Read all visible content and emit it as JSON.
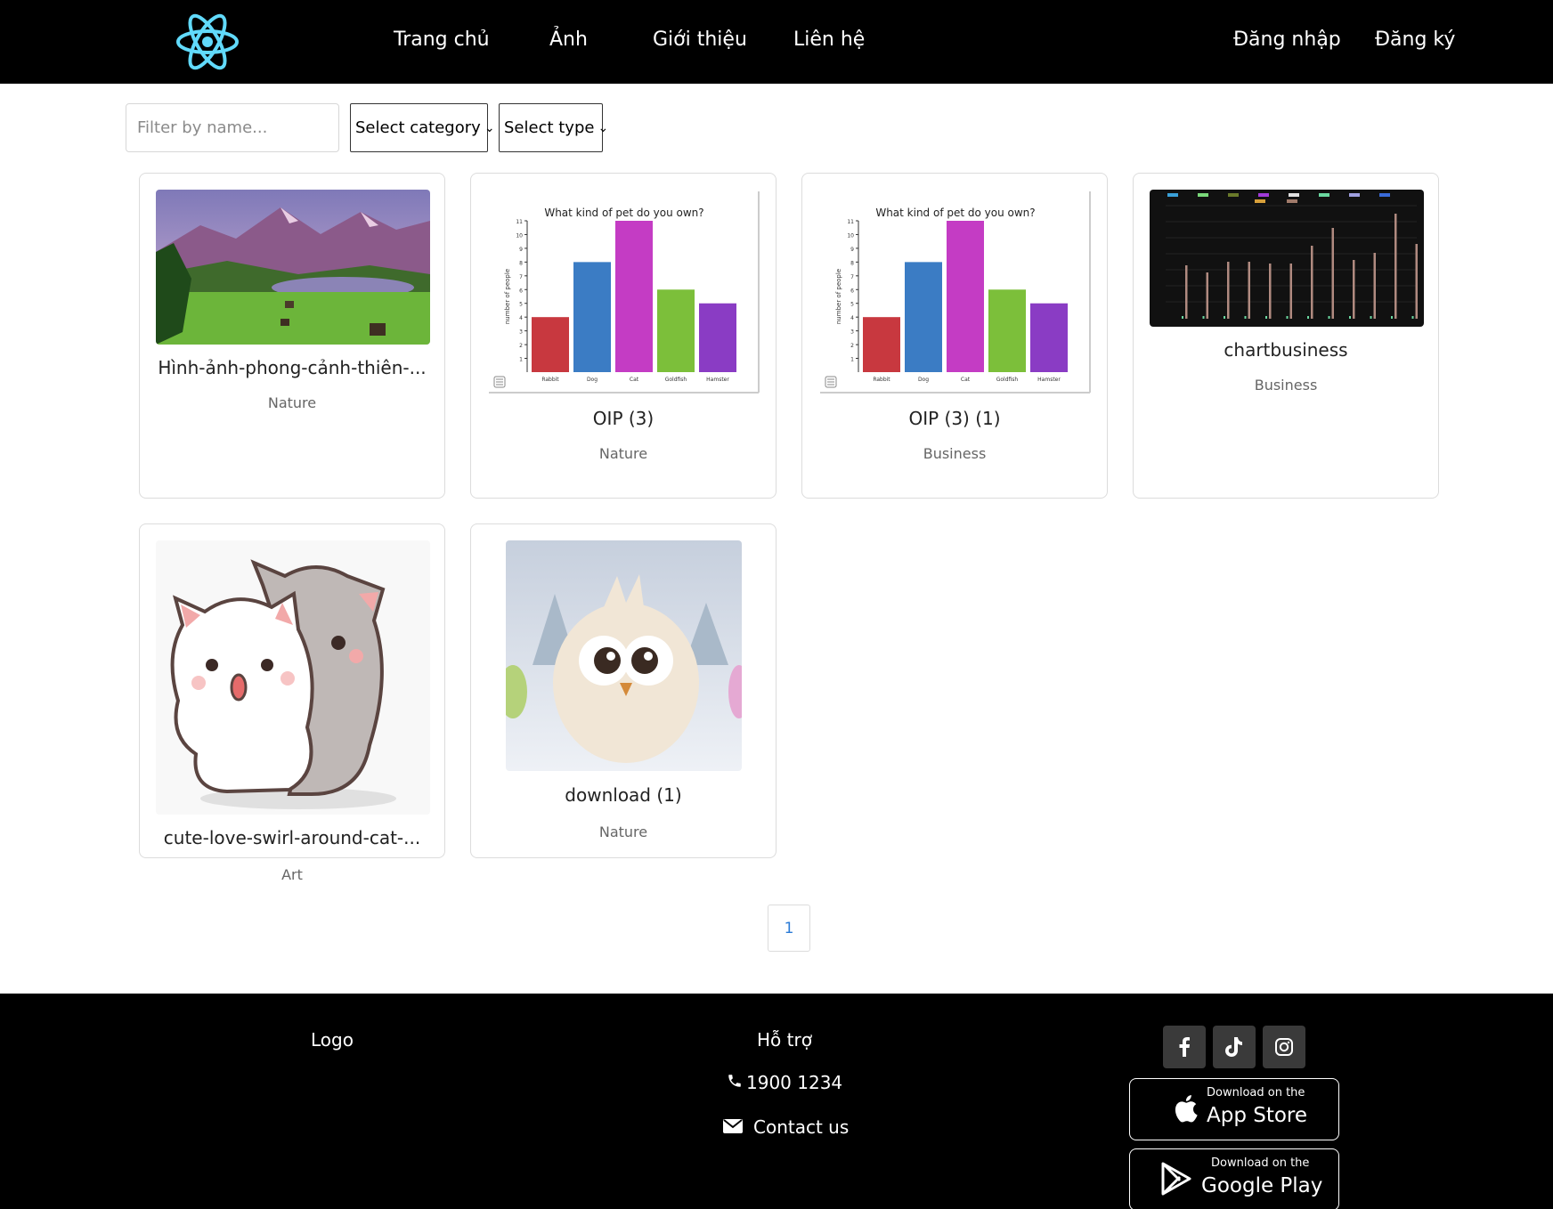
{
  "nav": {
    "logo_icon": "react-atom-icon",
    "links": [
      "Trang chủ",
      "Ảnh",
      "Giới thiệu",
      "Liên hệ"
    ],
    "login": "Đăng nhập",
    "register": "Đăng ký"
  },
  "filters": {
    "name_placeholder": "Filter by name...",
    "category": "Select category",
    "type": "Select type"
  },
  "cards": [
    {
      "title": "Hình-ảnh-phong-cảnh-thiên-...",
      "category": "Nature",
      "image": "mountain-lake-landscape"
    },
    {
      "title": "OIP (3)",
      "category": "Nature",
      "image": "pet-bar-chart"
    },
    {
      "title": "OIP (3) (1)",
      "category": "Business",
      "image": "pet-bar-chart"
    },
    {
      "title": "chartbusiness",
      "category": "Business",
      "image": "dark-business-chart"
    },
    {
      "title": "cute-love-swirl-around-cat-...",
      "category": "Art",
      "image": "cartoon-cats"
    },
    {
      "title": "download (1)",
      "category": "Nature",
      "image": "fluffy-chick"
    }
  ],
  "pet_chart": {
    "title": "What kind of pet do you own?",
    "ylabel": "number of people",
    "categories": [
      "Rabbit",
      "Dog",
      "Cat",
      "Goldfish",
      "Hamster"
    ],
    "values": [
      4,
      8,
      11,
      6,
      5
    ],
    "colors": [
      "#c8383f",
      "#3b7cc4",
      "#c43cc4",
      "#7cbf3a",
      "#8a3cc4"
    ],
    "yticks": [
      "1",
      "2",
      "3",
      "4",
      "5",
      "6",
      "7",
      "8",
      "9",
      "10",
      "11"
    ]
  },
  "pagination": {
    "current": "1"
  },
  "footer": {
    "logo": "Logo",
    "support_title": "Hỗ trợ",
    "phone": "1900 1234",
    "contact": "Contact us",
    "social_icons": [
      "facebook-icon",
      "tiktok-icon",
      "instagram-icon"
    ],
    "app_store": {
      "small": "Download on the",
      "big": "App Store"
    },
    "google_play": {
      "small": "Download on the",
      "big": "Google Play"
    }
  }
}
